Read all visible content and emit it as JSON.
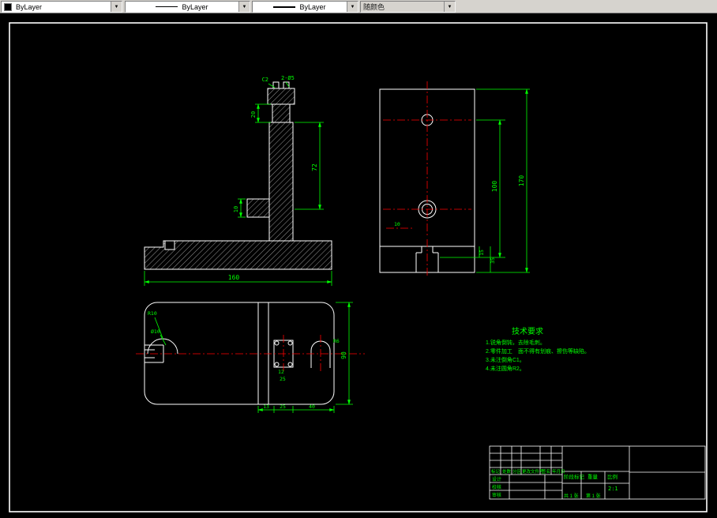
{
  "toolbar": {
    "color": "ByLayer",
    "linetype": "ByLayer",
    "lineweight": "ByLayer",
    "plot_style": "随颜色"
  },
  "icons": {
    "dropdown": "▼"
  },
  "front": {
    "callout_left": "C2",
    "callout_right": "2-Ø5",
    "neck": "20",
    "height": "72",
    "step": "10",
    "width": "160"
  },
  "side": {
    "offset": "10",
    "inner_height": "100",
    "total_height": "170",
    "slot_depth": "15",
    "slot_width": "35"
  },
  "top": {
    "radius": "R10",
    "hole": "Ø10",
    "height": "90",
    "d1": "13",
    "d2": "25",
    "d3": "40",
    "p1": "12",
    "p2": "25",
    "r2": "R6"
  },
  "tech": {
    "title": "技术要求",
    "l1": "1.锐角倒钝，去除毛刺。",
    "l2a": "2.零件加工",
    "l2b": "面不得有划痕、擦伤等缺陷。",
    "l3": "3.未注倒角C1。",
    "l4": "4.未注圆角R2。"
  },
  "tb": {
    "h1": "标记",
    "h2": "处数",
    "h3": "分区",
    "h4": "更改文件号",
    "h5": "签名",
    "h6": "年月日",
    "r1": "设计",
    "r2": "校核",
    "r3": "审核",
    "stage": "阶段标记",
    "weight": "重量",
    "scale": "比例",
    "scale_v": "2:1",
    "s1": "共 1 张",
    "s2": "第 1 张"
  }
}
